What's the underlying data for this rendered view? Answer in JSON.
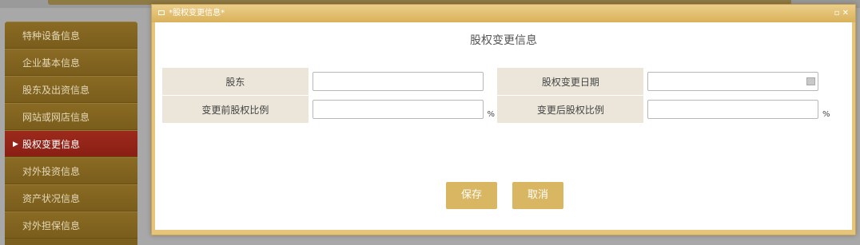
{
  "sidebar": {
    "items": [
      {
        "label": "特种设备信息"
      },
      {
        "label": "企业基本信息"
      },
      {
        "label": "股东及出资信息"
      },
      {
        "label": "网站或网店信息"
      },
      {
        "label": "股权变更信息",
        "active": true
      },
      {
        "label": "对外投资信息"
      },
      {
        "label": "资产状况信息"
      },
      {
        "label": "对外担保信息"
      }
    ]
  },
  "dialog": {
    "title": "*股权变更信息*",
    "window_controls": "▫ ✕",
    "form_title": "股权变更信息",
    "fields": {
      "shareholder_label": "股东",
      "shareholder_value": "",
      "change_date_label": "股权变更日期",
      "change_date_value": "",
      "before_ratio_label": "变更前股权比例",
      "before_ratio_value": "",
      "after_ratio_label": "变更后股权比例",
      "after_ratio_value": "",
      "percent_unit": "%"
    },
    "buttons": {
      "save": "保存",
      "cancel": "取消"
    }
  },
  "colors": {
    "sidebar_bg": "#7a5f1e",
    "sidebar_active": "#8a1f14",
    "dialog_frame": "#e6c47a",
    "button_bg": "#d9b662",
    "label_cell_bg": "#ebe6d9"
  }
}
